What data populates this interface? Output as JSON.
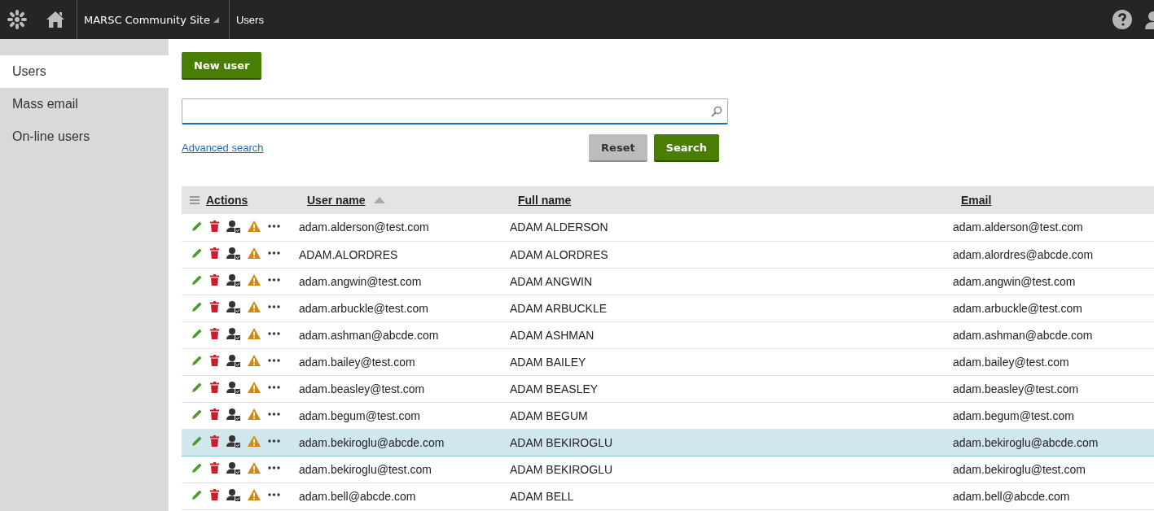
{
  "header": {
    "site": "MARSC Community Site",
    "breadcrumb": "Users"
  },
  "sidebar": {
    "items": [
      {
        "label": "Users",
        "selected": true
      },
      {
        "label": "Mass email",
        "selected": false
      },
      {
        "label": "On-line users",
        "selected": false
      }
    ]
  },
  "new_user_button": "New user",
  "advanced_search_link": "Advanced search",
  "buttons": [
    "Reset",
    "Search"
  ],
  "table": {
    "columns": [
      {
        "label": "Actions",
        "sorted": false
      },
      {
        "label": "User name",
        "sorted": true
      },
      {
        "label": "Full name",
        "sorted": false
      },
      {
        "label": "Email",
        "sorted": false
      }
    ],
    "rows": [
      {
        "user_name": "adam.alderson@test.com",
        "full_name": "ADAM ALDERSON",
        "email": "adam.alderson@test.com",
        "selected": false
      },
      {
        "user_name": "ADAM.ALORDRES",
        "full_name": "ADAM ALORDRES",
        "email": "adam.alordres@abcde.com",
        "selected": false
      },
      {
        "user_name": "adam.angwin@test.com",
        "full_name": "ADAM ANGWIN",
        "email": "adam.angwin@test.com",
        "selected": false
      },
      {
        "user_name": "adam.arbuckle@test.com",
        "full_name": "ADAM ARBUCKLE",
        "email": "adam.arbuckle@test.com",
        "selected": false
      },
      {
        "user_name": "adam.ashman@abcde.com",
        "full_name": "ADAM ASHMAN",
        "email": "adam.ashman@abcde.com",
        "selected": false
      },
      {
        "user_name": "adam.bailey@test.com",
        "full_name": "ADAM BAILEY",
        "email": "adam.bailey@test.com",
        "selected": false
      },
      {
        "user_name": "adam.beasley@test.com",
        "full_name": "ADAM BEASLEY",
        "email": "adam.beasley@test.com",
        "selected": false
      },
      {
        "user_name": "adam.begum@test.com",
        "full_name": "ADAM BEGUM",
        "email": "adam.begum@test.com",
        "selected": false
      },
      {
        "user_name": "adam.bekiroglu@abcde.com",
        "full_name": "ADAM BEKIROGLU",
        "email": "adam.bekiroglu@abcde.com",
        "selected": true
      },
      {
        "user_name": "adam.bekiroglu@test.com",
        "full_name": "ADAM BEKIROGLU",
        "email": "adam.bekiroglu@test.com",
        "selected": false
      },
      {
        "user_name": "adam.bell@abcde.com",
        "full_name": "ADAM BELL",
        "email": "adam.bell@abcde.com",
        "selected": false
      }
    ]
  }
}
